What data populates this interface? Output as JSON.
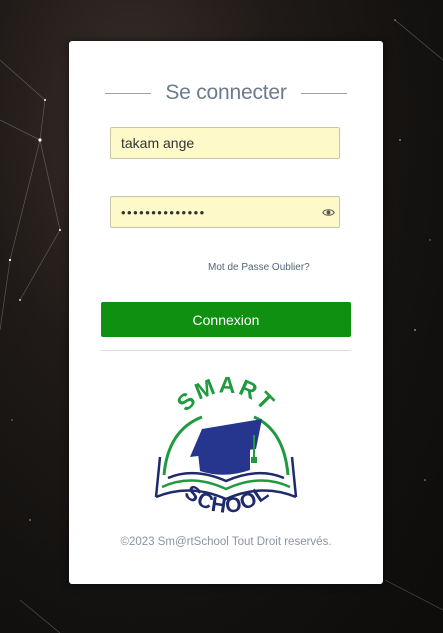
{
  "login": {
    "title": "Se connecter",
    "username_value": "takam ange",
    "password_value": "••••••••••••••",
    "forgot_link": "Mot de Passe Oublier?",
    "submit_label": "Connexion"
  },
  "logo": {
    "word_top": "SMART",
    "word_bottom": "SCHOOL",
    "brand_green": "#1f9a3f",
    "brand_navy": "#1f2a6b",
    "cap_blue": "#26368f"
  },
  "footer": {
    "copyright": "©2023 Sm@rtSchool Tout Droit reservés."
  },
  "colors": {
    "button_green": "#109010",
    "field_bg": "#fdf9c9",
    "title_color": "#6b7b8c"
  }
}
